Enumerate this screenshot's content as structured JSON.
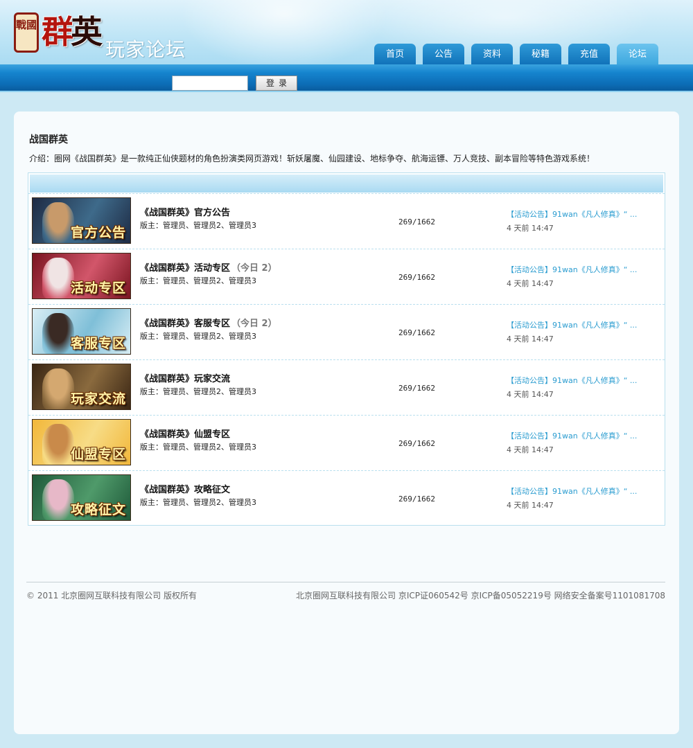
{
  "header": {
    "logo_seal": "戰國",
    "logo_main_1": "群",
    "logo_main_2": "英",
    "subtitle": "玩家论坛"
  },
  "nav": [
    {
      "label": "首页"
    },
    {
      "label": "公告"
    },
    {
      "label": "资料"
    },
    {
      "label": "秘籍"
    },
    {
      "label": "充值"
    },
    {
      "label": "论坛",
      "active": true
    }
  ],
  "login": {
    "input_value": "",
    "button_label": "登录"
  },
  "forum": {
    "title": "战国群英",
    "intro": "介绍：圈网《战国群英》是一款纯正仙侠题材的角色扮演类网页游戏！斩妖屠魔、仙园建设、地标争夺、航海运镖、万人竞技、副本冒险等特色游戏系统！"
  },
  "boards": [
    {
      "thumb_caption": "官方公告",
      "name": "《战国群英》官方公告",
      "today": "",
      "moderators": "版主：管理员、管理员2、管理员3",
      "stats": "269/1662",
      "last_post": "【活动公告】91wan《凡人修真》“ ...",
      "last_time": "4 天前 14:47",
      "colors": [
        "#1e2b44",
        "#3e6a8a",
        "#c89a6a"
      ]
    },
    {
      "thumb_caption": "活动专区",
      "name": "《战国群英》活动专区",
      "today": "（今日 2）",
      "moderators": "版主：管理员、管理员2、管理员3",
      "stats": "269/1662",
      "last_post": "【活动公告】91wan《凡人修真》“ ...",
      "last_time": "4 天前 14:47",
      "colors": [
        "#7a1420",
        "#d2566a",
        "#f0e4e4"
      ]
    },
    {
      "thumb_caption": "客服专区",
      "name": "《战国群英》客服专区",
      "today": "（今日 2）",
      "moderators": "版主：管理员、管理员2、管理员3",
      "stats": "269/1662",
      "last_post": "【活动公告】91wan《凡人修真》“ ...",
      "last_time": "4 天前 14:47",
      "colors": [
        "#d9eef5",
        "#7fbfd8",
        "#3a2a24"
      ]
    },
    {
      "thumb_caption": "玩家交流",
      "name": "《战国群英》玩家交流",
      "today": "",
      "moderators": "版主：管理员、管理员2、管理员3",
      "stats": "269/1662",
      "last_post": "【活动公告】91wan《凡人修真》“ ...",
      "last_time": "4 天前 14:47",
      "colors": [
        "#3a2614",
        "#8a6a3e",
        "#d4a870"
      ]
    },
    {
      "thumb_caption": "仙盟专区",
      "name": "《战国群英》仙盟专区",
      "today": "",
      "moderators": "版主：管理员、管理员2、管理员3",
      "stats": "269/1662",
      "last_post": "【活动公告】91wan《凡人修真》“ ...",
      "last_time": "4 天前 14:47",
      "colors": [
        "#f2b73a",
        "#f7dc86",
        "#c98a4a"
      ]
    },
    {
      "thumb_caption": "攻略征文",
      "name": "《战国群英》攻略征文",
      "today": "",
      "moderators": "版主：管理员、管理员2、管理员3",
      "stats": "269/1662",
      "last_post": "【活动公告】91wan《凡人修真》“ ...",
      "last_time": "4 天前 14:47",
      "colors": [
        "#1f5a3a",
        "#4f9a6a",
        "#e7b8c8"
      ]
    }
  ],
  "footer": {
    "copyright": "© 2011 北京圈网互联科技有限公司 版权所有",
    "license": "北京圈网互联科技有限公司 京ICP证060542号 京ICP备05052219号 网络安全备案号1101081708"
  }
}
